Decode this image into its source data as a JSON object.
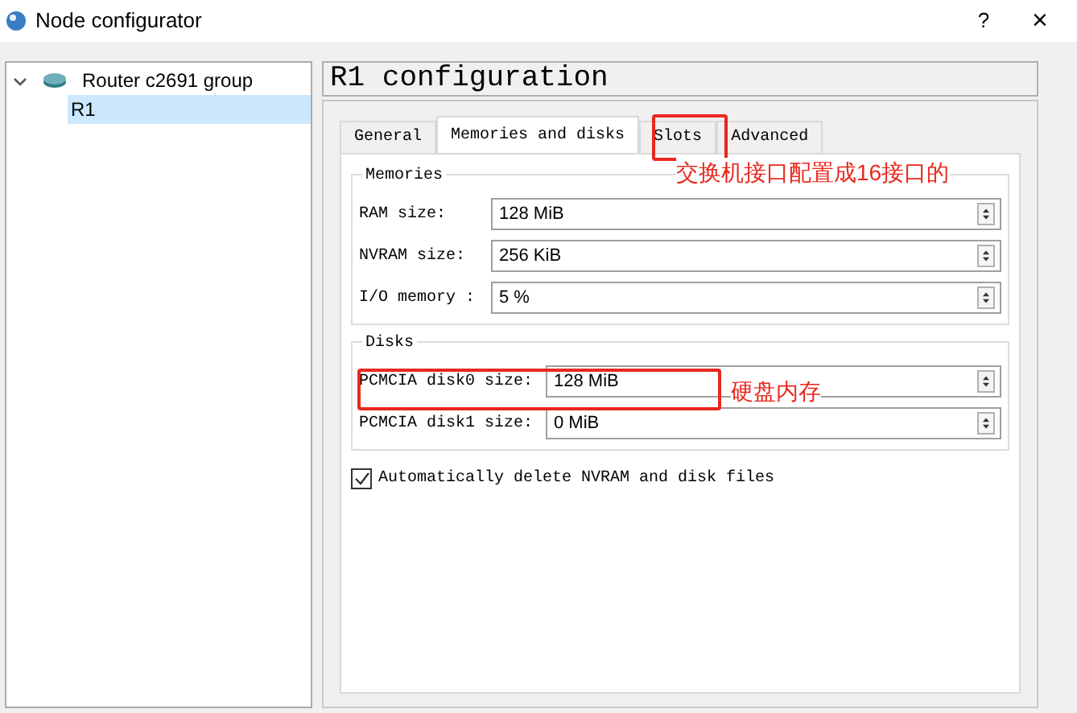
{
  "window": {
    "title": "Node configurator",
    "help": "?",
    "close": "×"
  },
  "tree": [
    {
      "label": "Router c2691 group",
      "expanded": true,
      "selected": false,
      "children": [
        {
          "label": "R1",
          "selected": true
        }
      ]
    }
  ],
  "header": "R1 configuration",
  "tabs": [
    {
      "label": "General",
      "selected": false
    },
    {
      "label": "Memories and disks",
      "selected": true
    },
    {
      "label": "Slots",
      "selected": false
    },
    {
      "label": "Advanced",
      "selected": false
    }
  ],
  "groups": [
    {
      "title": "Memories",
      "fields": [
        {
          "label": "RAM size:",
          "value": "128 MiB"
        },
        {
          "label": "NVRAM size:",
          "value": "256 KiB"
        },
        {
          "label": "I/O memory :",
          "value": "5 %"
        }
      ]
    },
    {
      "title": "Disks",
      "fields": [
        {
          "label": "PCMCIA disk0 size:",
          "value": "128 MiB"
        },
        {
          "label": "PCMCIA disk1 size:",
          "value": "0 MiB"
        }
      ]
    }
  ],
  "checkbox": {
    "label": "Automatically delete NVRAM and disk files",
    "checked": true
  },
  "annotations": [
    {
      "text": "交换机接口配置成16接口的"
    },
    {
      "text": "硬盘内存"
    }
  ]
}
